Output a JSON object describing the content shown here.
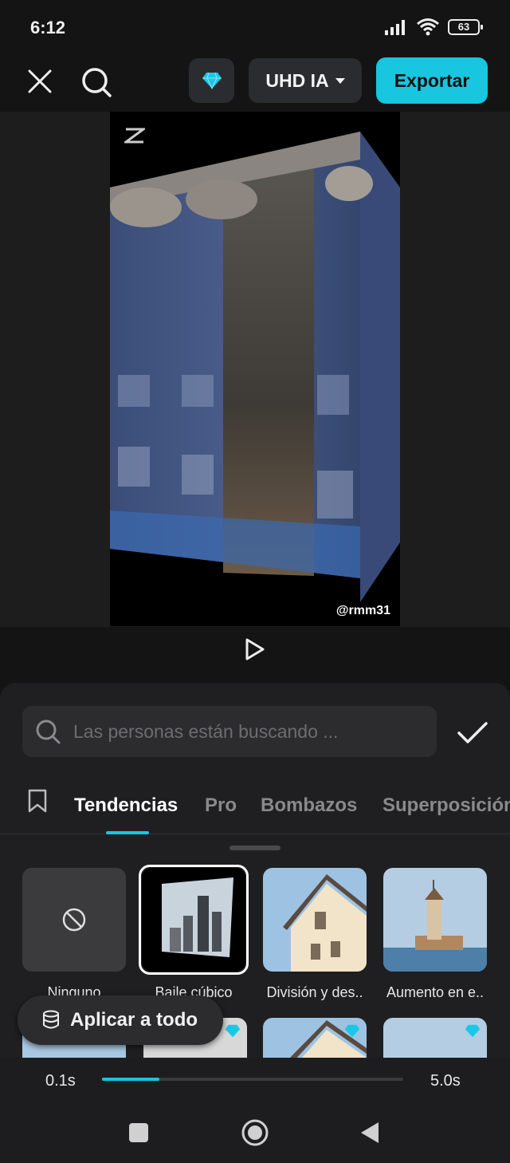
{
  "status_bar": {
    "time": "6:12",
    "battery": "63"
  },
  "toolbar": {
    "quality_label": "UHD IA",
    "export_label": "Exportar"
  },
  "preview": {
    "watermark": "@rmm31"
  },
  "search": {
    "placeholder": "Las personas están buscando ..."
  },
  "tabs": [
    {
      "label": "Tendencias",
      "active": true
    },
    {
      "label": "Pro"
    },
    {
      "label": "Bombazos"
    },
    {
      "label": "Superposición"
    }
  ],
  "effects": [
    {
      "label": "Ninguno"
    },
    {
      "label": "Baile cúbico",
      "selected": true
    },
    {
      "label": "División y des.."
    },
    {
      "label": "Aumento en e.."
    }
  ],
  "apply_all_label": "Aplicar a todo",
  "duration": {
    "min": "0.1s",
    "max": "5.0s",
    "value_fraction": 0.19
  },
  "colors": {
    "accent": "#18c6e0",
    "background": "#141414",
    "panel": "#1f1f21"
  },
  "icons": [
    "close-icon",
    "search-icon",
    "diamond-icon",
    "play-icon",
    "check-icon",
    "bookmark-icon",
    "forbidden-icon",
    "stack-icon",
    "nav-square-icon",
    "nav-circle-icon",
    "nav-back-icon"
  ]
}
